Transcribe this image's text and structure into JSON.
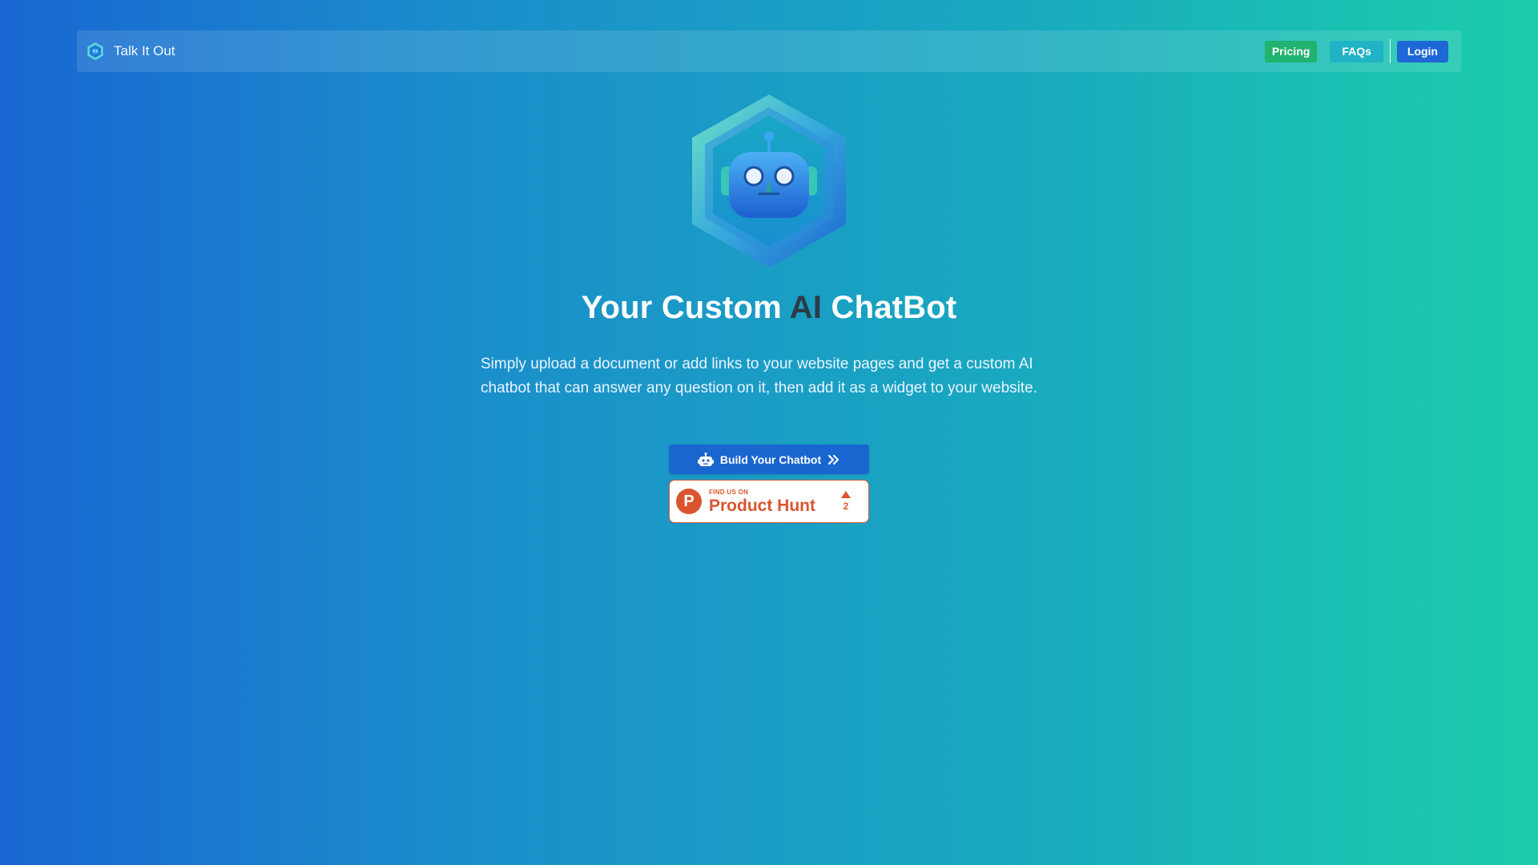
{
  "navbar": {
    "brand_name": "Talk It Out",
    "links": {
      "pricing": "Pricing",
      "faqs": "FAQs",
      "login": "Login"
    }
  },
  "hero": {
    "title_prefix": "Your Custom ",
    "title_accent": "AI",
    "title_suffix": " ChatBot",
    "description": "Simply upload a document or add links to your website pages and get a custom AI chatbot that can answer any question on it, then add it as a widget to your website.",
    "cta_label": "Build Your Chatbot"
  },
  "product_hunt": {
    "small_label": "FIND US ON",
    "big_label": "Product Hunt",
    "logo_letter": "P",
    "votes": "2"
  },
  "icons": {
    "brand": "hexagon-robot-logo",
    "hero": "hexagon-robot-illustration",
    "cta_leading": "robot-icon",
    "cta_trailing": "double-chevron-right-icon",
    "ph_vote": "upvote-triangle-icon"
  },
  "colors": {
    "gradient_start": "#1967d2",
    "gradient_end": "#1bcdab",
    "pricing_button": "#20b26f",
    "faqs_button": "#20b3c6",
    "login_button": "#1d67d6",
    "cta_button": "#1a66d1",
    "title_accent": "#2c3b44",
    "product_hunt": "#da552f"
  }
}
